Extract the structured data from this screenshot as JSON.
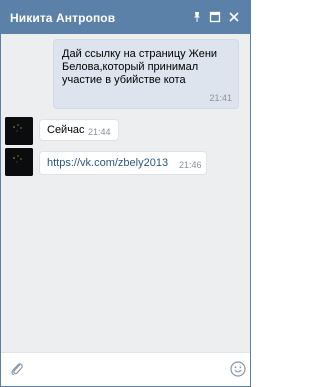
{
  "header": {
    "title": "Никита Антропов",
    "icons": [
      "pin-icon",
      "maximize-icon",
      "close-icon"
    ]
  },
  "messages": [
    {
      "direction": "out",
      "text_lines": [
        "Дай ссылку на страницу Жени",
        "Белова,который принимал",
        "участие в убийстве кота"
      ],
      "time": "21:41"
    },
    {
      "direction": "in",
      "text": "Сейчас",
      "time": "21:44"
    },
    {
      "direction": "in",
      "text": "https://vk.com/zbely2013",
      "time": "21:46"
    }
  ],
  "composer": {
    "attach_icon": "paperclip-icon",
    "emoji_icon": "smiley-icon"
  },
  "colors": {
    "header": "#5b81a8",
    "outgoing_bubble": "#dde4ee",
    "link": "#2a5885"
  }
}
